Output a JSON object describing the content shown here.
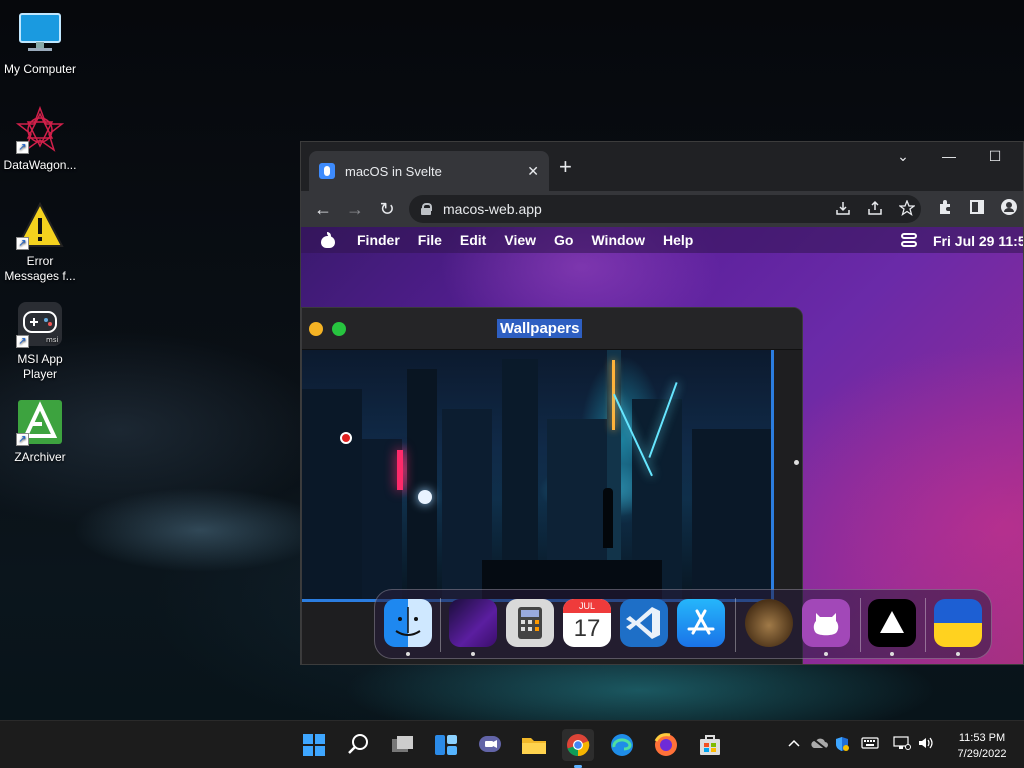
{
  "desktop": {
    "icons": [
      {
        "label": "My Computer"
      },
      {
        "label": "DataWagon..."
      },
      {
        "label": "Error Messages f..."
      },
      {
        "label": "MSI App Player"
      },
      {
        "label": "ZArchiver"
      }
    ]
  },
  "browser": {
    "tab_title": "macOS in Svelte",
    "tab_close": "✕",
    "new_tab": "+",
    "window_controls": {
      "minimize": "⌄",
      "restore": "—",
      "maximize": "☐",
      "close": "✕"
    },
    "nav": {
      "back": "←",
      "forward": "→",
      "reload": "↻"
    },
    "url": "macos-web.app"
  },
  "macos": {
    "menu": [
      "Finder",
      "File",
      "Edit",
      "View",
      "Go",
      "Window",
      "Help"
    ],
    "clock": "Fri Jul 29  11:5",
    "wallpapers_window": {
      "title": "Wallpapers"
    },
    "dock": {
      "calendar_month": "JUL",
      "calendar_day": "17",
      "apps": [
        "finder-icon",
        "wallpapers-icon",
        "calculator-icon",
        "calendar-icon",
        "vscode-icon",
        "app-store-icon",
        "cat-icon",
        "github-icon",
        "vercel-icon",
        "ukraine-flag-icon"
      ]
    }
  },
  "taskbar": {
    "time": "11:53 PM",
    "date": "7/29/2022"
  }
}
